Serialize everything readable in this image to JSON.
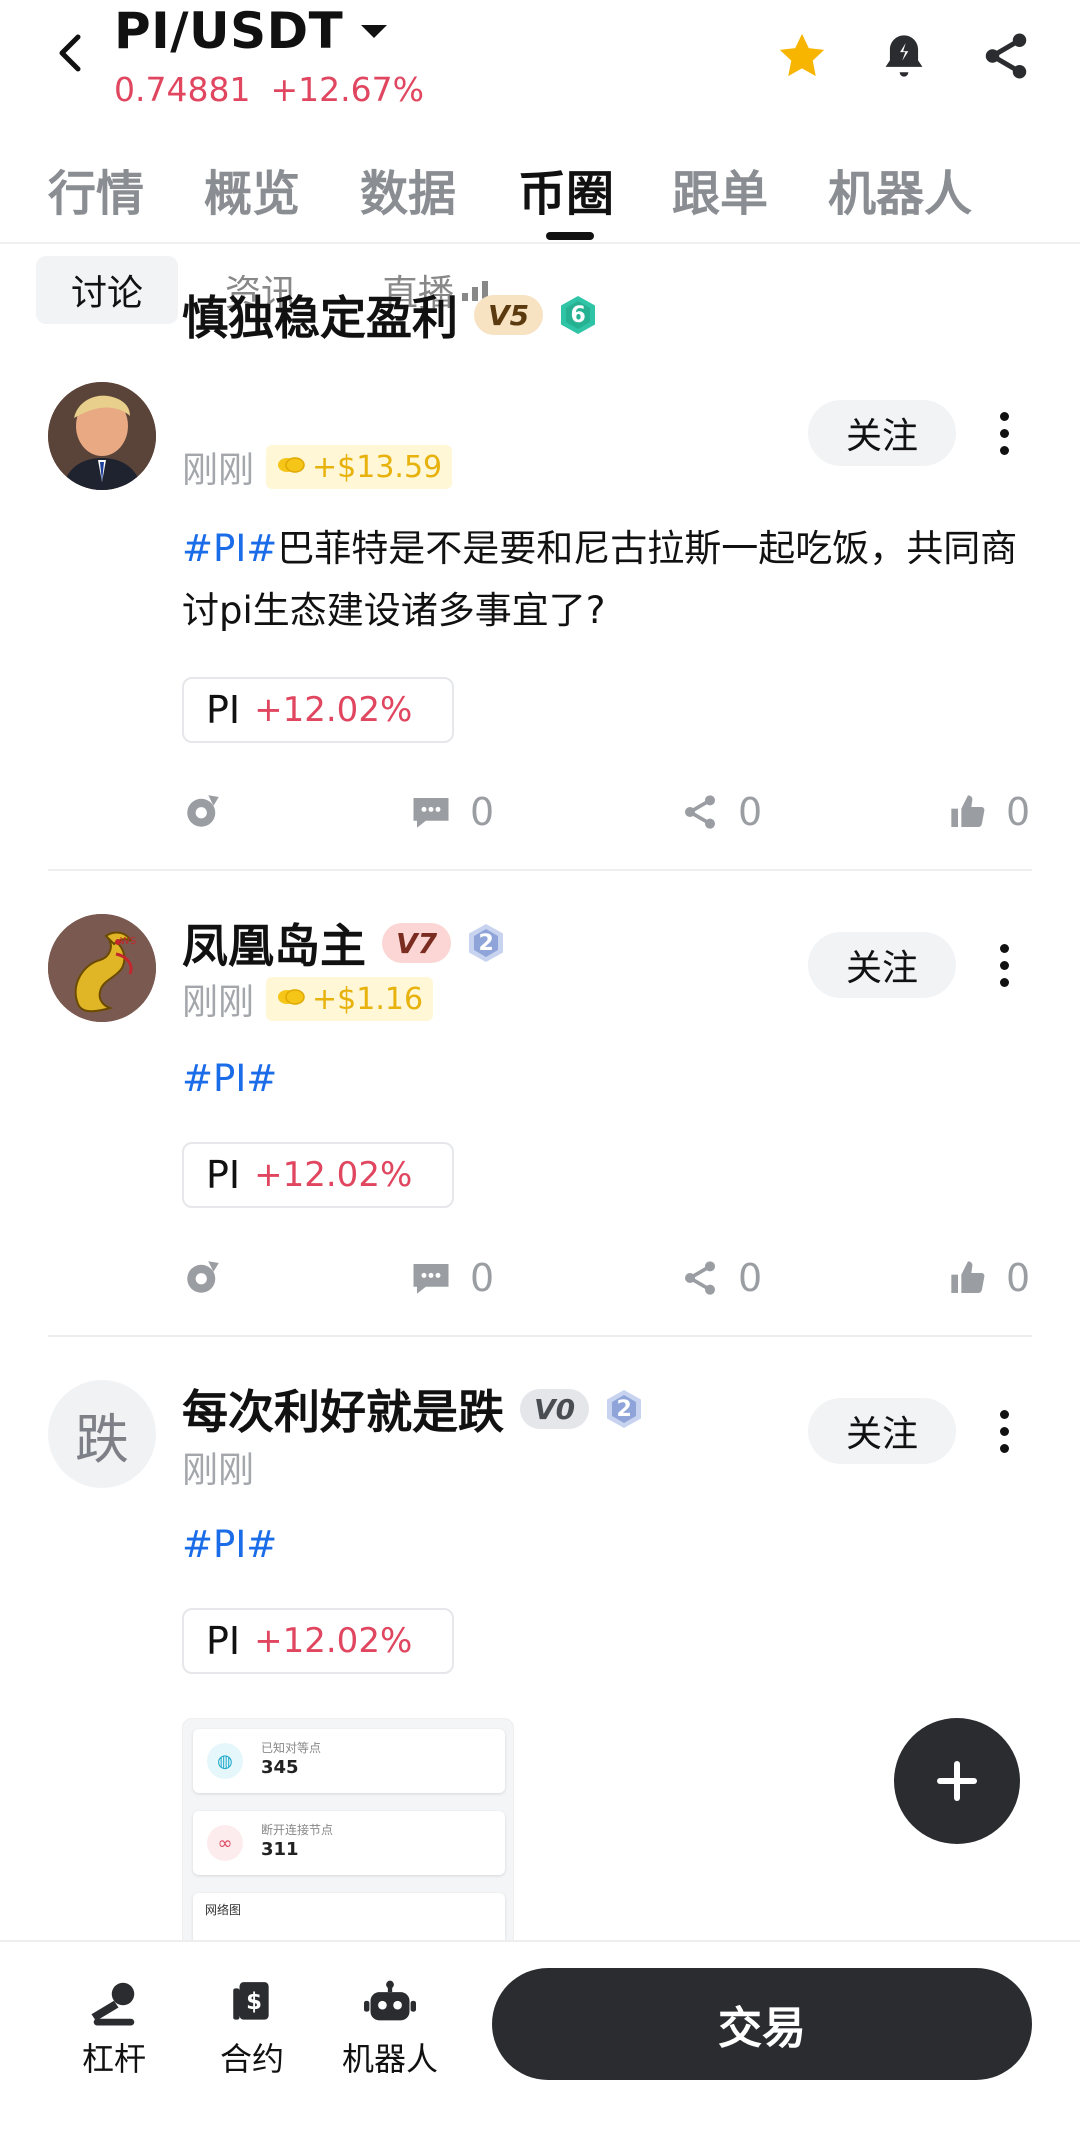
{
  "header": {
    "pair": "PI/USDT",
    "price": "0.74881",
    "change": "+12.67%"
  },
  "tabs": [
    "行情",
    "概览",
    "数据",
    "币圈",
    "跟单",
    "机器人"
  ],
  "active_tab": 3,
  "subtabs": [
    "讨论",
    "资讯",
    "直播"
  ],
  "posts": [
    {
      "username": "慎独稳定盈利",
      "vip": "V5",
      "level": "6",
      "time": "刚刚",
      "profit": "+$13.59",
      "follow": "关注",
      "hashtag": "#PI#",
      "text": "巴菲特是不是要和尼古拉斯一起吃饭，共同商讨pi生态建设诸多事宜了?",
      "coin": "PI",
      "coin_change": "+12.02%",
      "comments": "0",
      "shares": "0",
      "likes": "0"
    },
    {
      "username": "凤凰岛主",
      "vip": "V7",
      "level": "2",
      "time": "刚刚",
      "profit": "+$1.16",
      "follow": "关注",
      "hashtag": "#PI#",
      "text": "",
      "coin": "PI",
      "coin_change": "+12.02%",
      "comments": "0",
      "shares": "0",
      "likes": "0"
    },
    {
      "username": "每次利好就是跌",
      "avatar_char": "跌",
      "vip": "V0",
      "level": "2",
      "time": "刚刚",
      "follow": "关注",
      "hashtag": "#PI#",
      "coin": "PI",
      "coin_change": "+12.02%",
      "preview": {
        "card1_label": "已知对等点",
        "card1_value": "345",
        "card2_label": "断开连接节点",
        "card2_value": "311",
        "card3_label": "网络图"
      }
    }
  ],
  "bottom": {
    "leverage": "杠杆",
    "contract": "合约",
    "robot": "机器人",
    "trade": "交易"
  },
  "colors": {
    "up": "#e0465f",
    "hashtag": "#1a6ce8",
    "dark": "#2b2c2f",
    "gold": "#e8b20c"
  }
}
